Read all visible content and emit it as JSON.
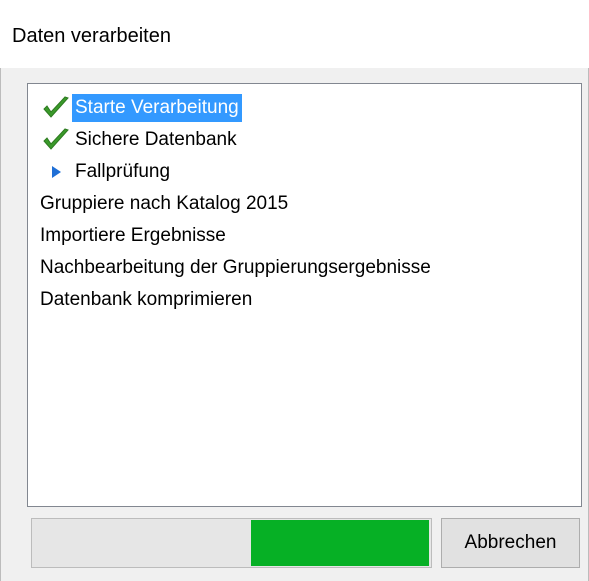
{
  "window": {
    "title": "Daten verarbeiten"
  },
  "steps": [
    {
      "label": "Starte Verarbeitung",
      "status": "done",
      "icon": "check-icon",
      "selected": true
    },
    {
      "label": "Sichere Datenbank",
      "status": "done",
      "icon": "check-icon",
      "selected": false
    },
    {
      "label": "Fallprüfung",
      "status": "running",
      "icon": "arrow-right-icon",
      "selected": false
    },
    {
      "label": "Gruppiere nach Katalog 2015",
      "status": "pending",
      "icon": "",
      "selected": false
    },
    {
      "label": "Importiere Ergebnisse",
      "status": "pending",
      "icon": "",
      "selected": false
    },
    {
      "label": "Nachbearbeitung der Gruppierungsergebnisse",
      "status": "pending",
      "icon": "",
      "selected": false
    },
    {
      "label": "Datenbank komprimieren",
      "status": "pending",
      "icon": "",
      "selected": false
    }
  ],
  "progress": {
    "segment_start": 0.55,
    "segment_end": 0.995
  },
  "buttons": {
    "cancel_label": "Abbrechen"
  },
  "colors": {
    "selection": "#3399ff",
    "check": "#3a9a2a",
    "arrow": "#1f6fd6",
    "progress_fill": "#06b025"
  }
}
